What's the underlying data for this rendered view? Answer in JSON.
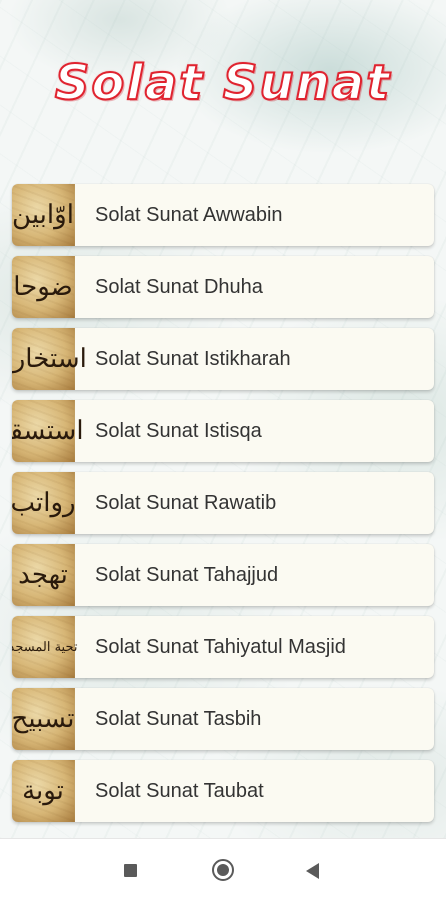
{
  "header": {
    "title": "Solat Sunat"
  },
  "items": [
    {
      "label": "Solat Sunat Awwabin",
      "thumb_text": "اوّابين"
    },
    {
      "label": "Solat Sunat Dhuha",
      "thumb_text": "ضوحا"
    },
    {
      "label": "Solat Sunat Istikharah",
      "thumb_text": "استخارة"
    },
    {
      "label": "Solat Sunat Istisqa",
      "thumb_text": "استسقا"
    },
    {
      "label": "Solat Sunat Rawatib",
      "thumb_text": "رواتب"
    },
    {
      "label": "Solat Sunat Tahajjud",
      "thumb_text": "تهجد"
    },
    {
      "label": "Solat Sunat Tahiyatul Masjid",
      "thumb_text": "تحية المسجد"
    },
    {
      "label": "Solat Sunat Tasbih",
      "thumb_text": "تسبيح"
    },
    {
      "label": "Solat Sunat Taubat",
      "thumb_text": "توبة"
    }
  ],
  "navbar": {
    "recents_icon": "square-icon",
    "home_icon": "circle-home-icon",
    "back_icon": "triangle-back-icon"
  },
  "colors": {
    "title_outline": "#e0232f",
    "card_bg": "#fbfaf2",
    "label": "#333333"
  }
}
